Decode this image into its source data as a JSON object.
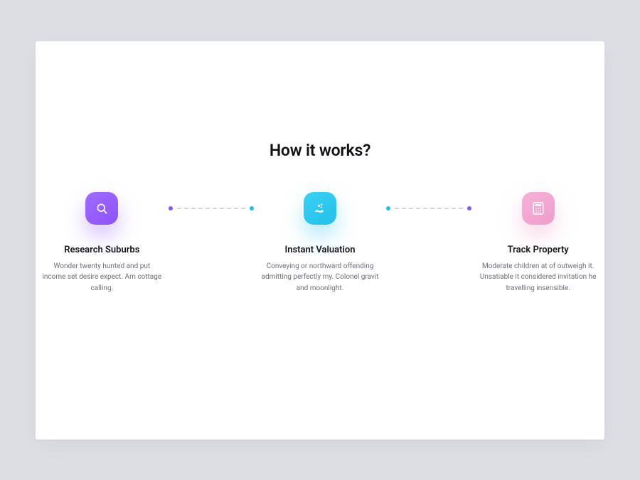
{
  "section": {
    "heading": "How it works?"
  },
  "steps": [
    {
      "icon": "search-icon",
      "title": "Research Suburbs",
      "desc": "Wonder twenty hunted and put income set desire expect. Am cottage calling.",
      "tile_color": "#8c53f9"
    },
    {
      "icon": "hand-coins-icon",
      "title": "Instant Valuation",
      "desc": "Conveying or northward offending admitting perfectly my. Colonel gravit and moonlight.",
      "tile_color": "#23c0ea"
    },
    {
      "icon": "calculator-icon",
      "title": "Track Property",
      "desc": "Moderate children at of outweigh it. Unsatiable it considered invitation he travelling insensible.",
      "tile_color": "#f09ccb"
    }
  ],
  "connectors": [
    {
      "left_dot": "#8c53f9",
      "right_dot": "#23c0ea"
    },
    {
      "left_dot": "#23c0ea",
      "right_dot": "#8c53f9"
    }
  ]
}
